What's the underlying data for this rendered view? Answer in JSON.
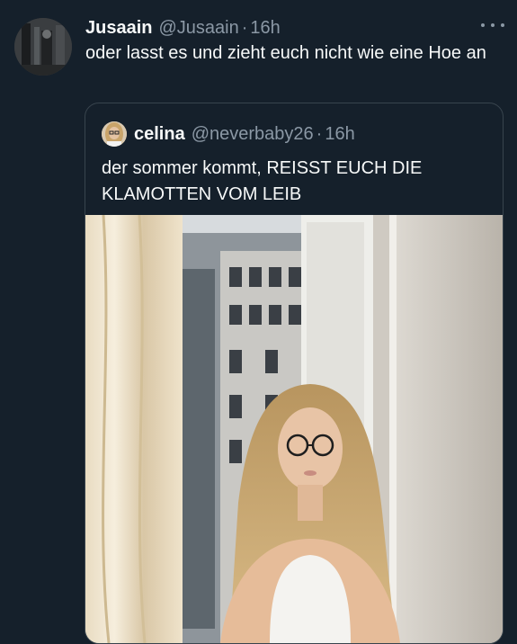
{
  "tweet": {
    "author_name": "Jusaain",
    "author_handle": "@Jusaain",
    "separator": "·",
    "time": "16h",
    "text": "oder lasst es und zieht euch nicht wie eine Hoe an",
    "more_icon": "more-horizontal-icon"
  },
  "quoted": {
    "author_name": "celina",
    "author_handle": "@neverbaby26",
    "separator": "·",
    "time": "16h",
    "text": "der sommer kommt, REISST EUCH DIE KLAMOTTEN VOM LEIB"
  },
  "colors": {
    "background": "#15202b",
    "text_primary": "#f7f9f9",
    "text_secondary": "#8b98a5",
    "border": "#38444d"
  }
}
